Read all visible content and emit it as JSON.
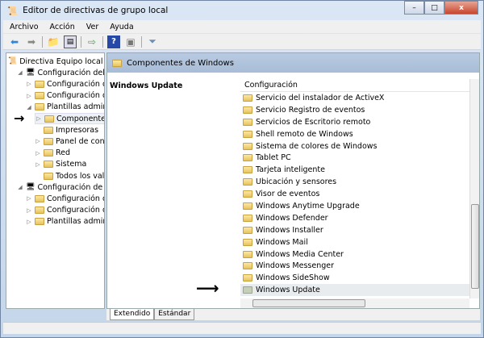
{
  "window": {
    "title": "Editor de directivas de grupo local",
    "minimize": "–",
    "maximize": "□",
    "close": "x"
  },
  "menu": [
    "Archivo",
    "Acción",
    "Ver",
    "Ayuda"
  ],
  "toolbar": [
    "back-icon",
    "forward-icon",
    "up-folder-icon",
    "show-hide-tree-icon",
    "export-list-icon",
    "help-icon",
    "properties-pane-icon",
    "filter-icon"
  ],
  "tree": [
    {
      "label": "Directiva Equipo local",
      "level": 0,
      "exp": ""
    },
    {
      "label": "Configuración del ec",
      "level": 1,
      "exp": "◢"
    },
    {
      "label": "Configuración de",
      "level": 2,
      "exp": "▷"
    },
    {
      "label": "Configuración de",
      "level": 2,
      "exp": "▷"
    },
    {
      "label": "Plantillas adminis",
      "level": 2,
      "exp": "◢"
    },
    {
      "label": "Componente",
      "level": 3,
      "exp": "▷",
      "selected": true
    },
    {
      "label": "Impresoras",
      "level": 3,
      "exp": ""
    },
    {
      "label": "Panel de cont",
      "level": 3,
      "exp": "▷"
    },
    {
      "label": "Red",
      "level": 3,
      "exp": "▷"
    },
    {
      "label": "Sistema",
      "level": 3,
      "exp": "▷"
    },
    {
      "label": "Todos los valo",
      "level": 3,
      "exp": ""
    },
    {
      "label": "Configuración de usu",
      "level": 1,
      "exp": "◢"
    },
    {
      "label": "Configuración de",
      "level": 2,
      "exp": "▷"
    },
    {
      "label": "Configuración de",
      "level": 2,
      "exp": "▷"
    },
    {
      "label": "Plantillas adminis",
      "level": 2,
      "exp": "▷"
    }
  ],
  "right": {
    "header": "Componentes de Windows",
    "selected_title": "Windows Update",
    "column": "Configuración",
    "items": [
      "Servicio del instalador de ActiveX",
      "Servicio Registro de eventos",
      "Servicios de Escritorio remoto",
      "Shell remoto de Windows",
      "Sistema de colores de Windows",
      "Tablet PC",
      "Tarjeta inteligente",
      "Ubicación y sensores",
      "Visor de eventos",
      "Windows Anytime Upgrade",
      "Windows Defender",
      "Windows Installer",
      "Windows Mail",
      "Windows Media Center",
      "Windows Messenger",
      "Windows SideShow",
      "Windows Update"
    ],
    "selected_index": 16
  },
  "tabs": [
    "Extendido",
    "Estándar"
  ],
  "active_tab": "Extendido"
}
